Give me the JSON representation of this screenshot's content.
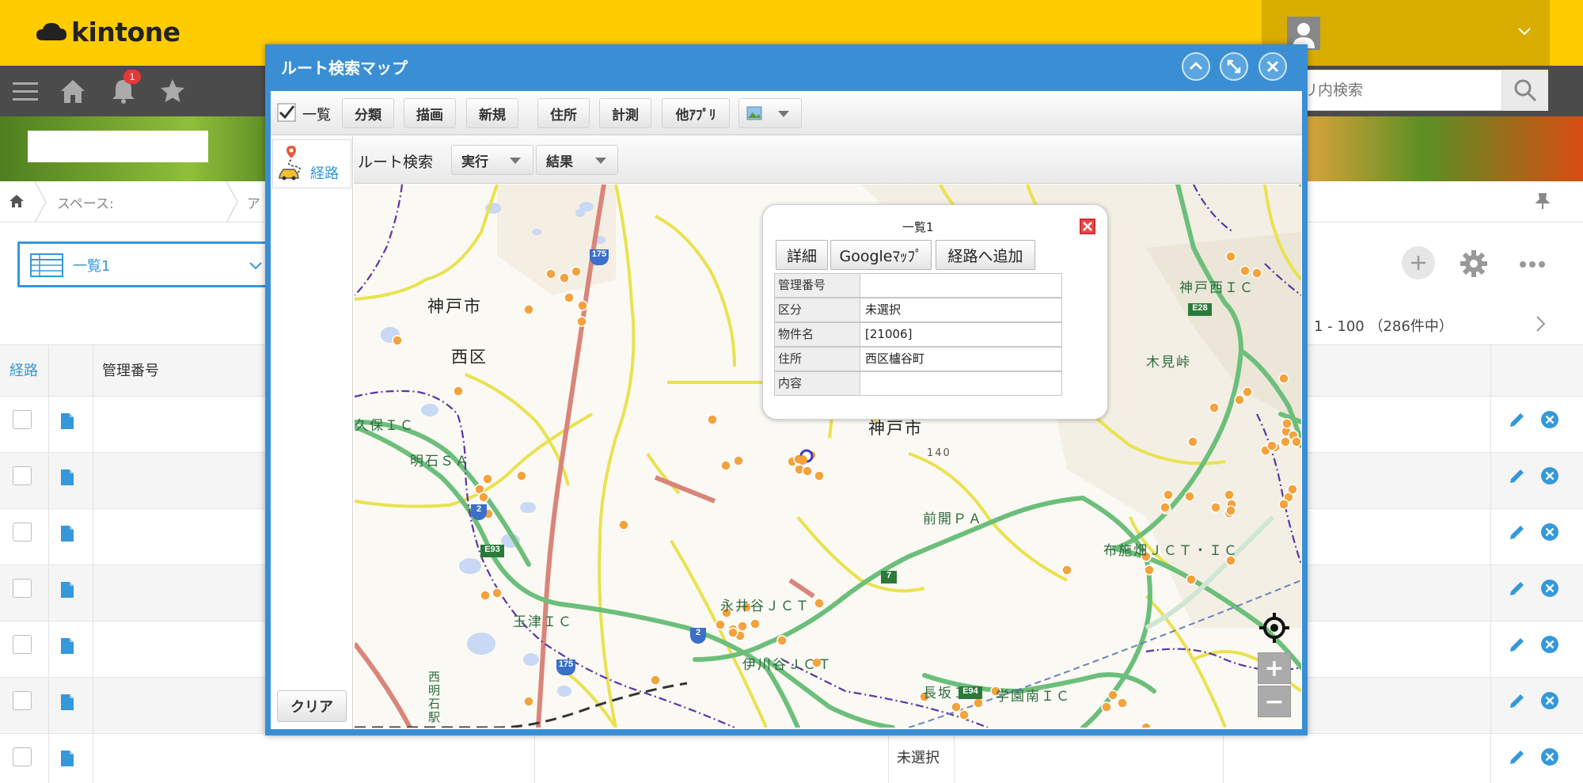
{
  "app": {
    "logo_text": "kintone",
    "notification_count": "1"
  },
  "search": {
    "placeholder": "リ内検索"
  },
  "breadcrumb": {
    "space": "スペース:",
    "app": "ア"
  },
  "view": {
    "label": "一覧1"
  },
  "pager": {
    "text": "1 - 100 （286件中）"
  },
  "table": {
    "headers": {
      "route": "経路",
      "mgmt_no": "管理番号"
    },
    "last_row_value": "未選択"
  },
  "dialog": {
    "title": "ルート検索マップ",
    "toolbar": {
      "list_check_label": "一覧",
      "buttons": [
        "分類",
        "描画",
        "新規",
        "住所",
        "計測",
        "他ｱﾌﾟﾘ"
      ]
    },
    "side": {
      "route_tab": "経路",
      "clear": "クリア"
    },
    "subbar": {
      "label": "ルート検索",
      "run": "実行",
      "result": "結果"
    }
  },
  "popup": {
    "title": "一覧1",
    "buttons": [
      "詳細",
      "Googleﾏｯﾌﾟ",
      "経路へ追加"
    ],
    "rows": [
      {
        "key": "管理番号",
        "value": ""
      },
      {
        "key": "区分",
        "value": "未選択"
      },
      {
        "key": "物件名",
        "value": "[21006]"
      },
      {
        "key": "住所",
        "value": "西区櫨谷町"
      },
      {
        "key": "内容",
        "value": ""
      }
    ]
  },
  "map": {
    "labels": {
      "kobe_city_left": "神戸市",
      "nishi_ku": "西区",
      "kobe_city_center": "神戸市",
      "akashi_sa": "明石ＳＡ",
      "kubo_ic": "久保ＩＣ",
      "tamatsu_ic": "玉津ＩＣ",
      "nagai_jct": "永井谷ＪＣＴ",
      "igawadani_jct": "伊川谷ＪＣＴ",
      "zenkai_pa": "前開ＰＡ",
      "fuse_jct": "布施畑ＪＣＴ・ＩＣ",
      "kobe_nishi_ic": "神戸西ＩＣ",
      "kimi_toge": "木見峠",
      "nagasaka_ic": "長坂ＩＣ",
      "gakuen_ic": "学園南ＩＣ",
      "nishi_akashi": "西明石駅",
      "elevation": "140"
    },
    "shields": {
      "r175a": "175",
      "r175b": "175",
      "r2a": "2",
      "r2b": "2",
      "e93": "E93",
      "e94": "E94",
      "e28": "E28",
      "r7": "7"
    },
    "controls": {
      "zoom_in": "+",
      "zoom_out": "−"
    }
  }
}
